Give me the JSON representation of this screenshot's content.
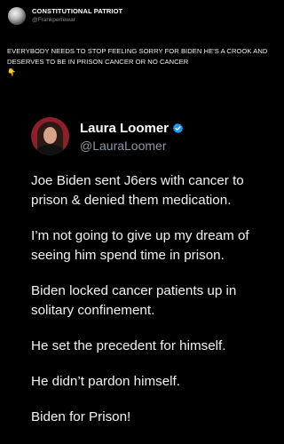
{
  "outer_post": {
    "display_name": "CONSTITUTIONAL PATRIOT",
    "handle": "@Frankperrewar",
    "text": "EVERYBODY NEEDS TO STOP FEELING SORRY FOR BIDEN HE'S A CROOK AND DESERVES TO BE IN PRISON CANCER OR NO CANCER",
    "emoji": "👇"
  },
  "quoted_post": {
    "display_name": "Laura Loomer",
    "handle": "@LauraLoomer",
    "verified_icon": "verified-badge-icon",
    "paragraphs": [
      "Joe Biden sent J6ers with cancer to prison & denied them medication.",
      "I’m not going to give up my dream of seeing him spend time in prison.",
      "Biden locked cancer patients up in solitary confinement.",
      "He set the precedent for himself.",
      "He didn’t pardon himself.",
      "Biden for Prison!"
    ]
  },
  "colors": {
    "background": "#000000",
    "text": "#f2f2f2",
    "muted": "#8b98a5",
    "verified": "#1d9bf0"
  }
}
